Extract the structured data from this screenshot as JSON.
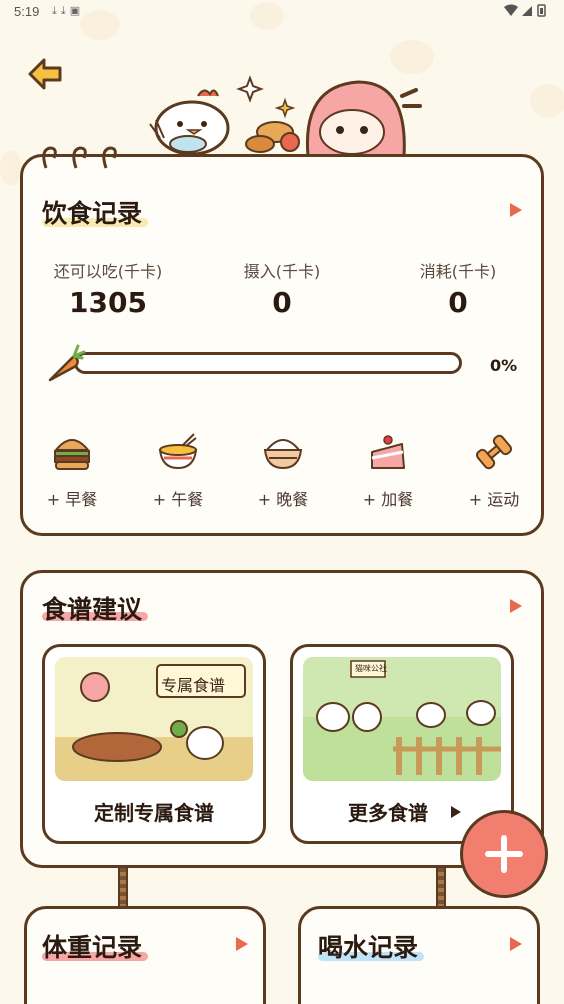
{
  "status_bar": {
    "time": "5:19"
  },
  "colors": {
    "accent": "#f27e6f",
    "border": "#5b3a20",
    "background": "#fdf8ec",
    "progress": "#f2a654"
  },
  "header": {
    "back_icon": "arrow-left-icon"
  },
  "diet": {
    "title": "饮食记录",
    "stats": [
      {
        "label": "还可以吃(千卡)",
        "value": "1305"
      },
      {
        "label": "摄入(千卡)",
        "value": "0"
      },
      {
        "label": "消耗(千卡)",
        "value": "0"
      }
    ],
    "progress": {
      "fraction": 0,
      "label": "0%"
    },
    "meals": [
      {
        "label": "+ 早餐",
        "icon": "burger-icon"
      },
      {
        "label": "+ 午餐",
        "icon": "noodle-bowl-icon"
      },
      {
        "label": "+ 晚餐",
        "icon": "rice-bowl-icon"
      },
      {
        "label": "+ 加餐",
        "icon": "cake-icon"
      },
      {
        "label": "+ 运动",
        "icon": "dumbbell-icon"
      }
    ]
  },
  "recipes": {
    "title": "食谱建议",
    "cards": [
      {
        "label": "定制专属食谱",
        "image_caption": "专属食谱"
      },
      {
        "label": "更多食谱",
        "image_caption": "猫咪公社"
      }
    ]
  },
  "weight": {
    "title": "体重记录"
  },
  "water": {
    "title": "喝水记录"
  },
  "fab": {
    "icon": "plus-icon"
  }
}
